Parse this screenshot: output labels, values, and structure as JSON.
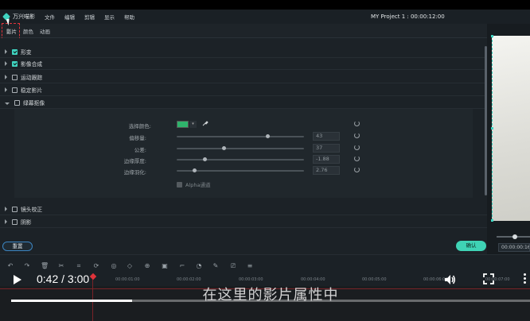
{
  "menubar": {
    "app_name": "万兴喵影",
    "items": [
      "文件",
      "编辑",
      "剪辑",
      "显示",
      "帮助"
    ],
    "project_title": "MY Project 1 : 00:00:12:00"
  },
  "tabs": [
    {
      "label": "影片",
      "active": true
    },
    {
      "label": "颜色",
      "active": false
    },
    {
      "label": "动画",
      "active": false
    }
  ],
  "sections": [
    {
      "label": "形变",
      "checked": true,
      "expanded": false
    },
    {
      "label": "影像合成",
      "checked": true,
      "expanded": false
    },
    {
      "label": "运动跟踪",
      "checked": false,
      "expanded": false
    },
    {
      "label": "稳定影片",
      "checked": false,
      "expanded": false
    },
    {
      "label": "绿幕抠像",
      "checked": false,
      "expanded": true
    },
    {
      "label": "镜头校正",
      "checked": false,
      "expanded": false
    },
    {
      "label": "阴影",
      "checked": false,
      "expanded": false
    }
  ],
  "chroma": {
    "color_label": "选择颜色:",
    "swatch_color": "#2fb36c",
    "params": [
      {
        "label": "偏移量:",
        "value": "43",
        "fraction": 0.71
      },
      {
        "label": "公差:",
        "value": "37",
        "fraction": 0.37
      },
      {
        "label": "边缘厚度:",
        "value": "-1.88",
        "fraction": 0.22
      },
      {
        "label": "边缘羽化:",
        "value": "2.76",
        "fraction": 0.14
      }
    ],
    "alpha_label": "Alpha通道"
  },
  "buttons": {
    "reset": "重置",
    "ok": "确认"
  },
  "preview": {
    "time": "00:00:00:16"
  },
  "ruler_ticks": [
    "00:00:01:00",
    "00:00:02:00",
    "00:00:03:00",
    "00:00:04:00",
    "00:00:05:00",
    "00:00:06:00",
    "00:00:07:00"
  ],
  "player": {
    "current": "0:42",
    "total": "3:00",
    "time_display": "0:42 / 3:00",
    "progress": 0.233,
    "subtitle": "在这里的影片属性中"
  },
  "colors": {
    "accent": "#3fd3c0",
    "ok_button": "#3fd3b5",
    "playhead": "#e0333a"
  }
}
